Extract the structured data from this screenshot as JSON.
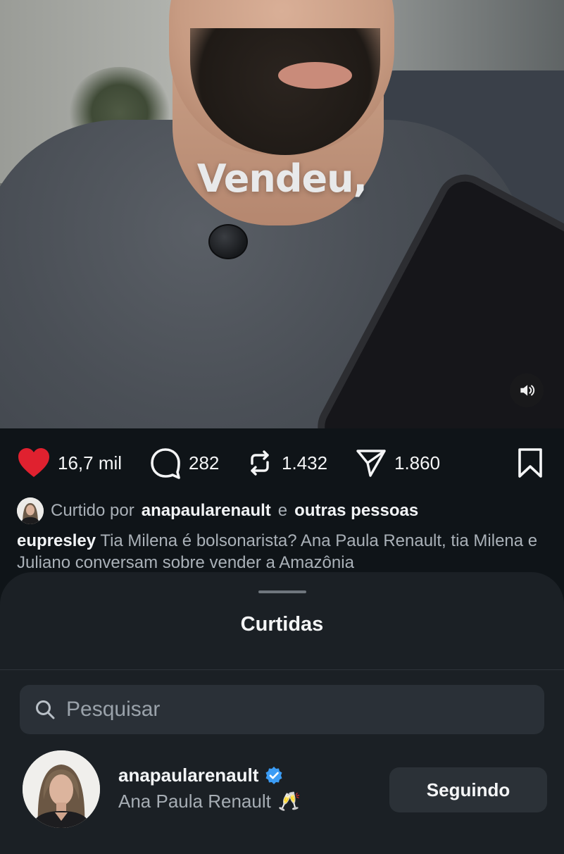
{
  "video": {
    "caption": "Vendeu,"
  },
  "actions": {
    "likes": "16,7 mil",
    "comments": "282",
    "reposts": "1.432",
    "shares": "1.860",
    "like_color": "#e0212f"
  },
  "liked_by": {
    "prefix": "Curtido por",
    "user": "anapaularenault",
    "connector": "e",
    "others": "outras pessoas"
  },
  "post": {
    "author": "eupresley",
    "text": "Tia Milena é bolsonarista? Ana Paula Renault, tia Milena e Juliano conversam sobre vender a Amazônia"
  },
  "sheet": {
    "title": "Curtidas",
    "search_placeholder": "Pesquisar",
    "users": [
      {
        "username": "anapaularenault",
        "full_name": "Ana Paula Renault",
        "emoji": "🥂",
        "verified": true,
        "button_label": "Seguindo"
      }
    ]
  },
  "colors": {
    "background": "#0f1418",
    "sheet": "#1b2025",
    "verified": "#3b9cf5"
  }
}
